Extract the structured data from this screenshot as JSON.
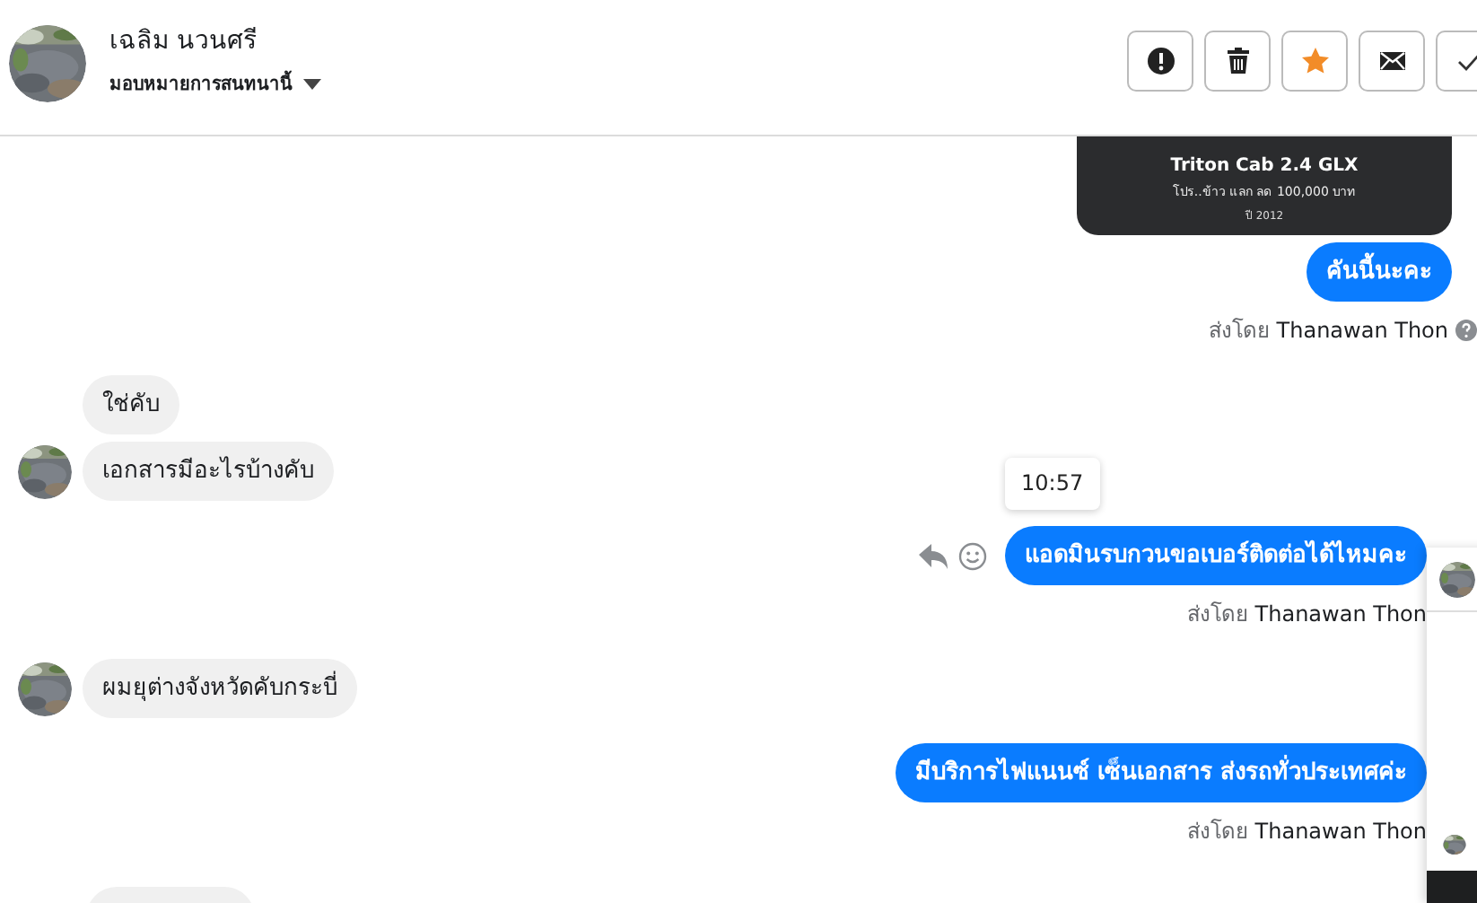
{
  "header": {
    "name": "เฉลิม นวนศรี",
    "assign_label": "มอบหมายการสนทนานี้"
  },
  "actions": [
    {
      "kind": "alert"
    },
    {
      "kind": "trash"
    },
    {
      "kind": "star",
      "on": true
    },
    {
      "kind": "mail"
    },
    {
      "kind": "check"
    }
  ],
  "messages": [
    {
      "kind": "card",
      "title": "Triton Cab 2.4 GLX",
      "promo": "โปร..ข้าว แลก ลด 100,000 บาท",
      "year": "ปี 2012"
    },
    {
      "kind": "sent",
      "text": "คันนี้นะคะ",
      "sender": "ส่งโดย **Thanawan Thon**",
      "help": true
    },
    {
      "kind": "received",
      "text": "ใช่คับ",
      "avatar": false
    },
    {
      "kind": "received",
      "text": "เอกสารมีอะไรบ้างคับ",
      "avatar": true
    },
    {
      "kind": "sent",
      "text": "แอดมินรบกวนขอเบอร์ติดต่อได้ไหมคะ",
      "time": "10:57",
      "hover": true,
      "sender": "ส่งโดย **Thanawan Thon**",
      "help": false
    },
    {
      "kind": "received",
      "text": "ผมยุต่างจังหวัดคับกระบี่",
      "avatar": true
    },
    {
      "kind": "sent",
      "text": "มีบริการไฟแนนซ์ เซ็นเอกสาร ส่งรถทั่วประเทศค่ะ",
      "sender": "ส่งโดย **Thanawan Thon**",
      "help": false
    },
    {
      "kind": "cut",
      "avatar": false
    }
  ]
}
